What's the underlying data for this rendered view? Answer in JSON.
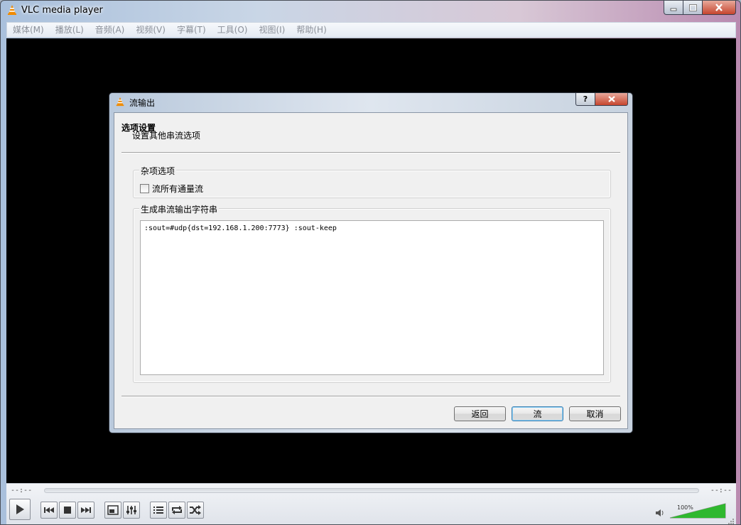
{
  "window": {
    "title": "VLC media player"
  },
  "menubar": {
    "items": [
      "媒体(M)",
      "播放(L)",
      "音频(A)",
      "视频(V)",
      "字幕(T)",
      "工具(O)",
      "视图(I)",
      "帮助(H)"
    ]
  },
  "dialog": {
    "title": "流输出",
    "help_label": "?",
    "section_title": "选项设置",
    "section_subtitle": "设置其他串流选项",
    "misc_group": {
      "label": "杂项选项",
      "checkbox_label": "流所有通量流",
      "checked": false
    },
    "output_group": {
      "label": "生成串流输出字符串",
      "value": ":sout=#udp{dst=192.168.1.200:7773} :sout-keep"
    },
    "buttons": {
      "back": "返回",
      "stream": "流",
      "cancel": "取消"
    }
  },
  "controls": {
    "time_elapsed": "--:--",
    "time_total": "--:--",
    "volume_label": "100%",
    "volume_level": 1.0,
    "icons": [
      "play-icon",
      "previous-icon",
      "stop-icon",
      "next-icon",
      "fullscreen-icon",
      "extended-settings-icon",
      "playlist-icon",
      "loop-icon",
      "shuffle-icon",
      "speaker-icon"
    ]
  },
  "colors": {
    "video_bg": "#000000",
    "volume_fill": "#2fb82f",
    "close_red": "#c6452e"
  }
}
